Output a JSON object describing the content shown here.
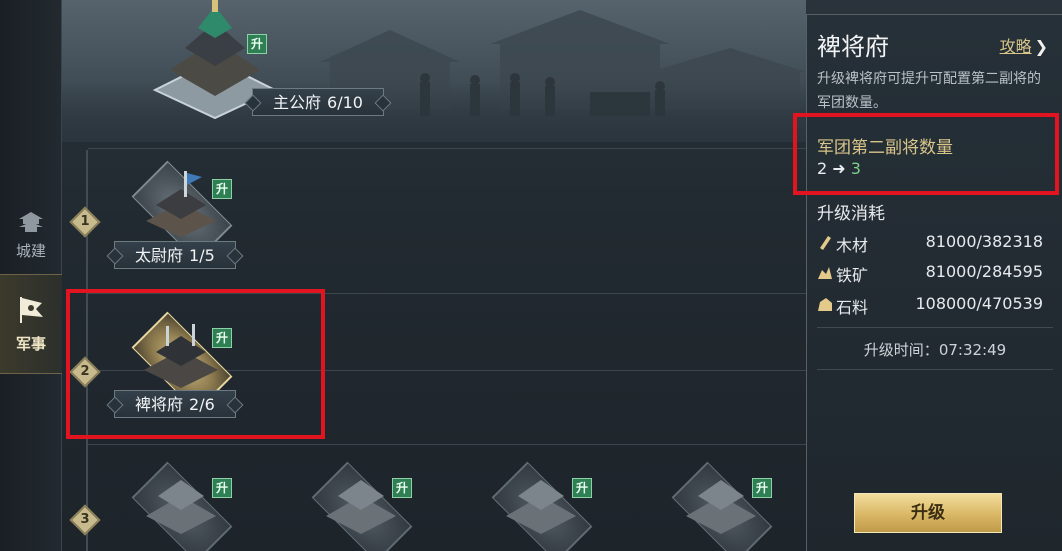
{
  "nav": [
    {
      "key": "city",
      "label": "城建",
      "icon": "pagoda-icon"
    },
    {
      "key": "military",
      "label": "军事",
      "icon": "flag-icon",
      "active": true
    }
  ],
  "main_hall": {
    "name": "主公府",
    "level": "6/10",
    "badge": "升"
  },
  "tiers": [
    "1",
    "2",
    "3"
  ],
  "tier1": [
    {
      "name": "太尉府",
      "level": "1/5",
      "badge": "升"
    }
  ],
  "tier2": [
    {
      "name": "裨将府",
      "level": "2/6",
      "badge": "升",
      "selected": true
    }
  ],
  "tier3": [
    {
      "badge": "升"
    },
    {
      "badge": "升"
    },
    {
      "badge": "升"
    },
    {
      "badge": "升"
    }
  ],
  "panel": {
    "title": "裨将府",
    "guide": "攻略",
    "guide_arrow": "❯",
    "description": "升级裨将府可提升可配置第二副将的军团数量。",
    "effect_label": "军团第二副将数量",
    "effect_from": "2",
    "effect_arrow": "➜",
    "effect_to": "3",
    "cost_label": "升级消耗",
    "resources": [
      {
        "name": "木材",
        "value": "81000/382318",
        "icon": "wood-icon"
      },
      {
        "name": "铁矿",
        "value": "81000/284595",
        "icon": "iron-ore-icon"
      },
      {
        "name": "石料",
        "value": "108000/470539",
        "icon": "stone-icon"
      }
    ],
    "time_label": "升级时间：",
    "time_value": "07:32:49",
    "upgrade_button": "升级"
  },
  "colors": {
    "highlight": "#e1141f",
    "gold_text": "#d9c58a",
    "upgrade_badge": "#2e7f53",
    "button_gold": "#d9b765"
  }
}
